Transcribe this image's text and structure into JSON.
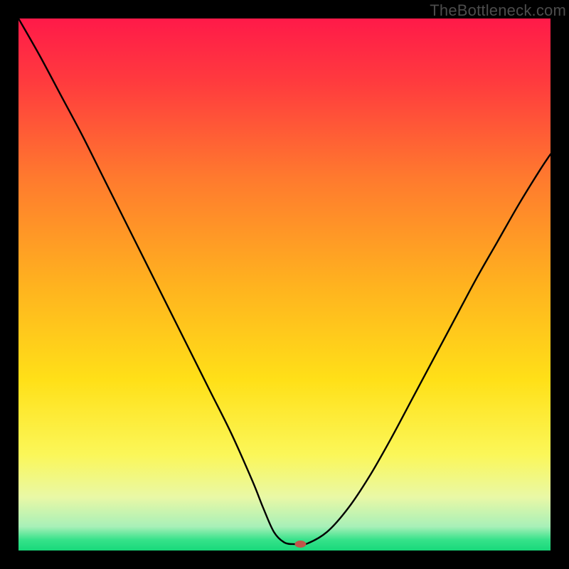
{
  "watermark": "TheBottleneck.com",
  "chart_data": {
    "type": "line",
    "title": "",
    "xlabel": "",
    "ylabel": "",
    "xlim": [
      0,
      100
    ],
    "ylim": [
      0,
      100
    ],
    "grid": false,
    "background_gradient": {
      "stops": [
        {
          "offset": 0.0,
          "color": "#ff1a49"
        },
        {
          "offset": 0.12,
          "color": "#ff3b3e"
        },
        {
          "offset": 0.3,
          "color": "#ff7a2e"
        },
        {
          "offset": 0.5,
          "color": "#ffb21f"
        },
        {
          "offset": 0.68,
          "color": "#ffe018"
        },
        {
          "offset": 0.82,
          "color": "#fbf759"
        },
        {
          "offset": 0.9,
          "color": "#e9f8a6"
        },
        {
          "offset": 0.955,
          "color": "#a8f0b8"
        },
        {
          "offset": 0.98,
          "color": "#36e28a"
        },
        {
          "offset": 1.0,
          "color": "#18d87a"
        }
      ]
    },
    "series": [
      {
        "name": "bottleneck-curve",
        "x": [
          0,
          4,
          8,
          12,
          16,
          20,
          24,
          28,
          32,
          36,
          40,
          44,
          46,
          48,
          50,
          52,
          54,
          58,
          62,
          66,
          70,
          74,
          78,
          82,
          86,
          90,
          94,
          98,
          100
        ],
        "y": [
          100,
          93,
          85.5,
          78,
          70,
          62,
          54,
          46,
          38,
          30,
          22,
          13,
          8,
          3.5,
          1.5,
          1.2,
          1.2,
          3.5,
          8,
          14,
          21,
          28.5,
          36,
          43.5,
          51,
          58,
          65,
          71.5,
          74.5
        ]
      }
    ],
    "marker": {
      "name": "optimal-point",
      "x": 53,
      "y": 1.2,
      "color": "#c0564a",
      "rx": 8,
      "ry": 5
    }
  }
}
